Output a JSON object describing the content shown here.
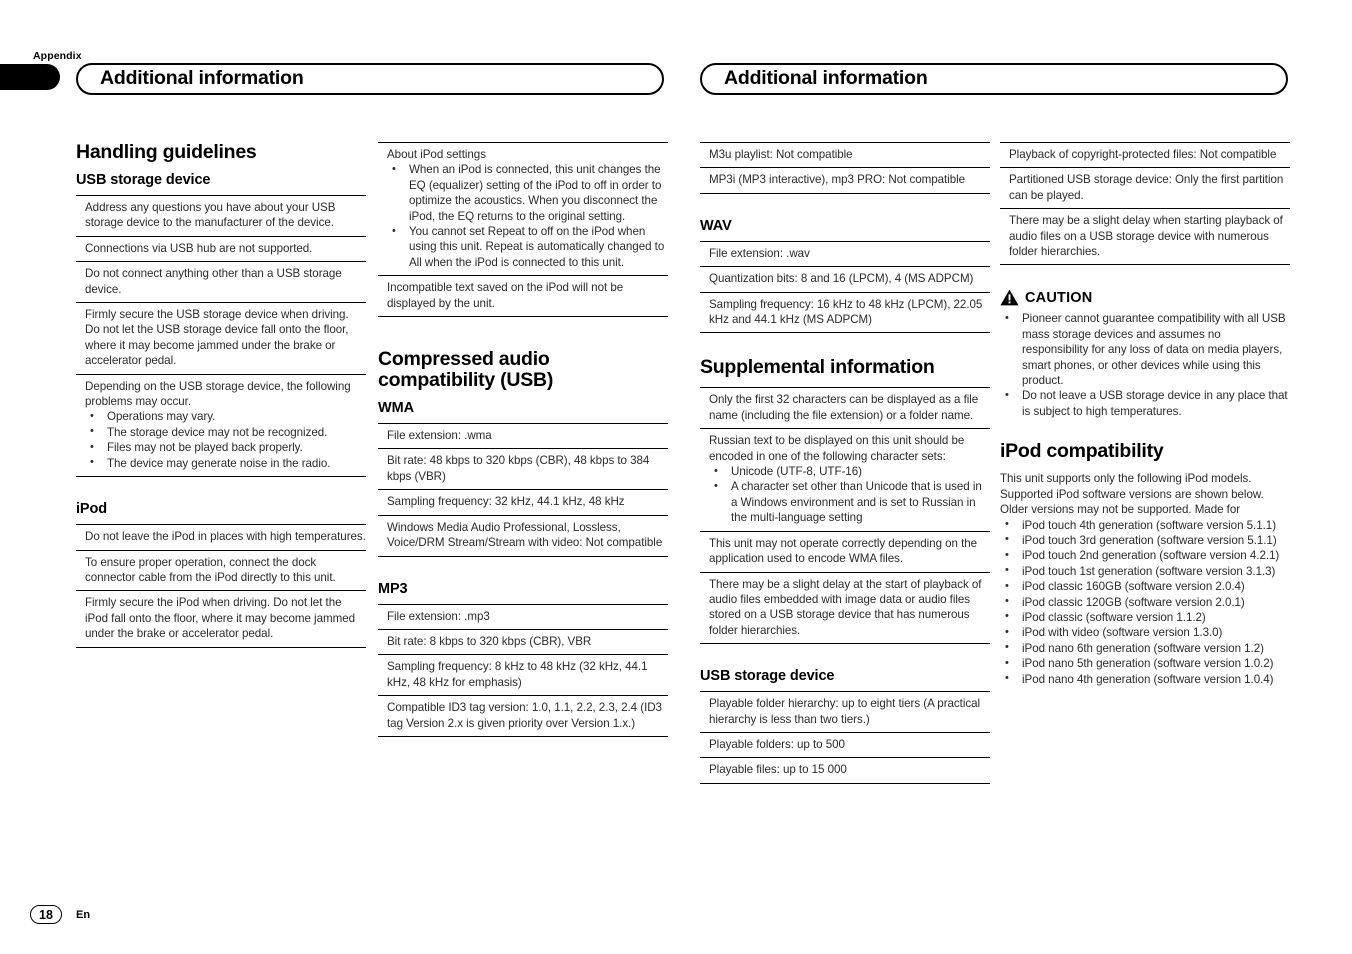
{
  "page": {
    "side_tab_label": "Appendix",
    "page_number": "18",
    "language_code": "En"
  },
  "running_head": {
    "left_title": "Additional information",
    "right_title": "Additional information"
  },
  "column1": {
    "heading": "Handling guidelines",
    "usb_sub": "USB storage device",
    "usb_rows": [
      "Address any questions you have about your USB storage device to the manufacturer of the device.",
      "Connections via USB hub are not supported.",
      "Do not connect anything other than a USB storage device.",
      "Firmly secure the USB storage device when driving. Do not let the USB storage device fall onto the floor, where it may become jammed under the brake or accelerator pedal."
    ],
    "usb_problems_intro": "Depending on the USB storage device, the following problems may occur.",
    "usb_problems_bullets": [
      "Operations may vary.",
      "The storage device may not be recognized.",
      "Files may not be played back properly.",
      "The device may generate noise in the radio."
    ],
    "ipod_sub": "iPod",
    "ipod_rows": [
      "Do not leave the iPod in places with high temperatures.",
      "To ensure proper operation, connect the dock connector cable from the iPod directly to this unit.",
      "Firmly secure the iPod when driving. Do not let the iPod fall onto the floor, where it may become jammed under the brake or accelerator pedal."
    ]
  },
  "column2": {
    "about_ipod_intro": "About iPod settings",
    "about_ipod_bullets": [
      "When an iPod is connected, this unit changes the EQ (equalizer) setting of the iPod to off in order to optimize the acoustics. When you disconnect the iPod, the EQ returns to the original setting.",
      "You cannot set Repeat to off on the iPod when using this unit. Repeat is automatically changed to All when the iPod is connected to this unit."
    ],
    "incompatible_text_row": "Incompatible text saved on the iPod will not be displayed by the unit.",
    "compressed_heading": "Compressed audio compatibility (USB)",
    "wma_sub": "WMA",
    "wma_rows": [
      "File extension: .wma",
      "Bit rate: 48 kbps to 320 kbps (CBR), 48 kbps to 384 kbps (VBR)",
      "Sampling frequency: 32 kHz, 44.1 kHz, 48 kHz",
      "Windows Media Audio Professional, Lossless, Voice/DRM Stream/Stream with video: Not compatible"
    ],
    "mp3_sub": "MP3",
    "mp3_rows": [
      "File extension: .mp3",
      "Bit rate: 8 kbps to 320 kbps (CBR), VBR",
      "Sampling frequency: 8 kHz to 48 kHz (32 kHz, 44.1 kHz, 48 kHz for emphasis)",
      "Compatible ID3 tag version: 1.0, 1.1, 2.2, 2.3, 2.4 (ID3 tag Version 2.x is given priority over Version 1.x.)"
    ]
  },
  "column3": {
    "mp3_cont_rows": [
      "M3u playlist: Not compatible",
      "MP3i (MP3 interactive), mp3 PRO: Not compatible"
    ],
    "wav_sub": "WAV",
    "wav_rows": [
      "File extension: .wav",
      "Quantization bits: 8 and 16 (LPCM), 4 (MS ADPCM)",
      "Sampling frequency: 16 kHz to 48 kHz (LPCM), 22.05 kHz and 44.1 kHz (MS ADPCM)"
    ],
    "supplemental_heading": "Supplemental information",
    "supp_row1": "Only the first 32 characters can be displayed as a file name (including the file extension) or a folder name.",
    "supp_row2_intro": "Russian text to be displayed on this unit should be encoded in one of the following character sets:",
    "supp_row2_bullets": [
      "Unicode (UTF-8, UTF-16)",
      "A character set other than Unicode that is used in a Windows environment and is set to Russian in the multi-language setting"
    ],
    "supp_row3": "This unit may not operate correctly depending on the application used to encode WMA files.",
    "supp_row4": "There may be a slight delay at the start of playback of audio files embedded with image data or audio files stored on a USB storage device that has numerous folder hierarchies.",
    "usb_sub": "USB storage device",
    "usb_rows": [
      "Playable folder hierarchy: up to eight tiers (A practical hierarchy is less than two tiers.)",
      "Playable folders: up to 500",
      "Playable files: up to 15 000"
    ]
  },
  "column4": {
    "usb_cont_rows": [
      "Playback of copyright-protected files: Not compatible",
      "Partitioned USB storage device: Only the first partition can be played.",
      "There may be a slight delay when starting playback of audio files on a USB storage device with numerous folder hierarchies."
    ],
    "caution_label": "CAUTION",
    "caution_bullets": [
      "Pioneer cannot guarantee compatibility with all USB mass storage devices and assumes no responsibility for any loss of data on media players, smart phones, or other devices while using this product.",
      "Do not leave a USB storage device in any place that is subject to high temperatures."
    ],
    "ipod_compat_heading": "iPod compatibility",
    "ipod_compat_intro": "This unit supports only the following iPod models. Supported iPod software versions are shown below. Older versions may not be supported. Made for",
    "ipod_models": [
      "iPod touch 4th generation (software version 5.1.1)",
      "iPod touch 3rd generation (software version 5.1.1)",
      "iPod touch 2nd generation (software version 4.2.1)",
      "iPod touch 1st generation (software version 3.1.3)",
      "iPod classic 160GB (software version 2.0.4)",
      "iPod classic 120GB (software version 2.0.1)",
      "iPod classic (software version 1.1.2)",
      "iPod with video (software version 1.3.0)",
      "iPod nano 6th generation (software version 1.2)",
      "iPod nano 5th generation (software version 1.0.2)",
      "iPod nano 4th generation (software version 1.0.4)"
    ]
  },
  "colors": {
    "rule": "#000000",
    "body_text": "#2b2b2b",
    "heading_text": "#000000"
  }
}
